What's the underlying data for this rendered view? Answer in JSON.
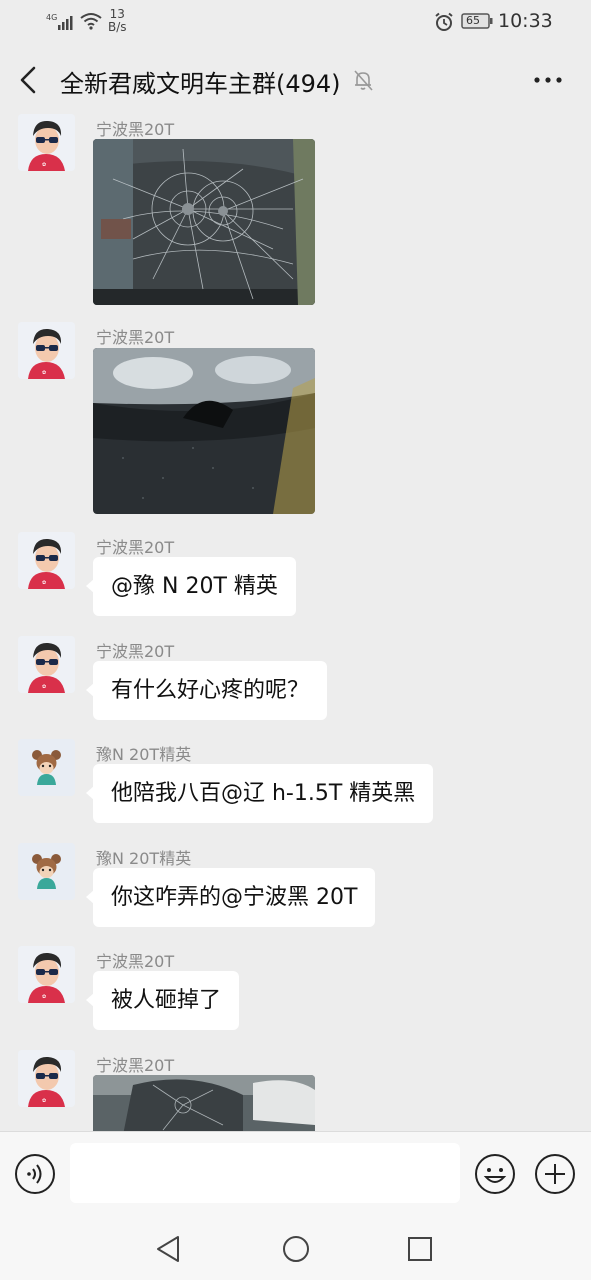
{
  "status_bar": {
    "network": "4G",
    "speed_value": "13",
    "speed_unit": "B/s",
    "battery": "65",
    "time": "10:33"
  },
  "header": {
    "title": "全新君威文明车主群(494)"
  },
  "messages": [
    {
      "sender": "宁波黑20T",
      "type": "image",
      "image": "cracked-windshield-photo"
    },
    {
      "sender": "宁波黑20T",
      "type": "image",
      "image": "damaged-headlight-photo"
    },
    {
      "sender": "宁波黑20T",
      "type": "text",
      "text": "@豫 N 20T 精英"
    },
    {
      "sender": "宁波黑20T",
      "type": "text",
      "text": "有什么好心疼的呢？"
    },
    {
      "sender": "豫N 20T精英",
      "type": "text",
      "text": "他陪我八百@辽 h-1.5T 精英黑"
    },
    {
      "sender": "豫N 20T精英",
      "type": "text",
      "text": "你这咋弄的@宁波黑 20T"
    },
    {
      "sender": "宁波黑20T",
      "type": "text",
      "text": "被人砸掉了"
    },
    {
      "sender": "宁波黑20T",
      "type": "image",
      "image": "smashed-car-photo"
    }
  ],
  "input": {
    "value": "",
    "placeholder": ""
  },
  "colors": {
    "background": "#ededed",
    "bubble": "#ffffff",
    "sender_text": "#8a8a8a"
  }
}
